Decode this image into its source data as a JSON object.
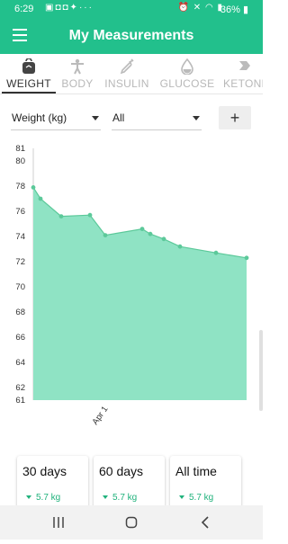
{
  "status_bar": {
    "time": "6:29",
    "left_icons": [
      "calendar-icon",
      "bag-icon",
      "bag-icon",
      "twitter-icon",
      "more-dots-icon"
    ],
    "right_icons": [
      "alarm-icon",
      "mute-icon",
      "wifi-icon",
      "signal-icon"
    ],
    "battery": "36%"
  },
  "app_bar": {
    "title": "My Measurements",
    "menu_icon": "hamburger-menu-icon"
  },
  "tabs": [
    {
      "label": "WEIGHT",
      "icon": "weight-icon",
      "active": true
    },
    {
      "label": "BODY",
      "icon": "body-icon",
      "active": false
    },
    {
      "label": "INSULIN",
      "icon": "syringe-icon",
      "active": false
    },
    {
      "label": "GLUCOSE",
      "icon": "drop-icon",
      "active": false
    },
    {
      "label": "KETONE",
      "icon": "ketone-icon",
      "active": false
    }
  ],
  "controls": {
    "measure_select": "Weight (kg)",
    "range_select": "All",
    "add_label": "+"
  },
  "chart_data": {
    "type": "area",
    "color": "#8fe3c4",
    "line_color": "#5cc99a",
    "ylim": [
      61,
      81
    ],
    "y_ticks": [
      61,
      62,
      64,
      66,
      68,
      70,
      72,
      74,
      76,
      78,
      80,
      81
    ],
    "x_tick_labels": [
      "Apr 1"
    ],
    "grid": false,
    "values": [
      77.9,
      77.0,
      75.6,
      75.7,
      74.1,
      74.6,
      74.2,
      73.8,
      73.2,
      72.7,
      72.3
    ],
    "series": [
      {
        "values": [
          77.9,
          77.0,
          75.6,
          75.7,
          74.1,
          74.6,
          74.2,
          73.8,
          73.2,
          72.7,
          72.3
        ]
      }
    ]
  },
  "summary_cards": [
    {
      "title": "30 days",
      "change": "5.7 kg"
    },
    {
      "title": "60 days",
      "change": "5.7 kg"
    },
    {
      "title": "All time",
      "change": "5.7 kg"
    }
  ],
  "nav_bar": {
    "buttons": [
      "recent-apps-icon",
      "home-icon",
      "back-icon"
    ]
  },
  "colors": {
    "primary": "#22c08c",
    "positive": "#20b27c"
  }
}
